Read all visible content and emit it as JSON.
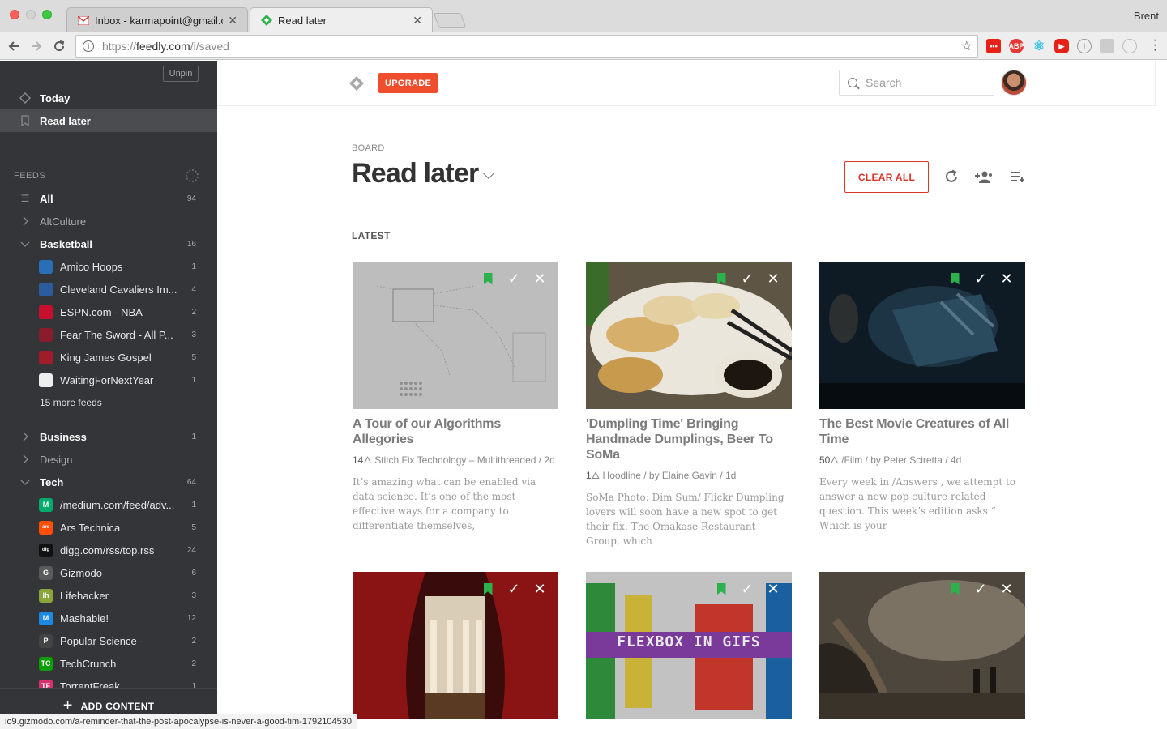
{
  "browser": {
    "tabs": [
      {
        "title": "Inbox - karmapoint@gmail.com",
        "active": false
      },
      {
        "title": "Read later",
        "active": true
      }
    ],
    "profile_name": "Brent",
    "url_prefix": "https://",
    "url_host": "feedly.com",
    "url_path": "/i/saved",
    "status_url": "io9.gizmodo.com/a-reminder-that-the-post-apocalypse-is-never-a-good-tim-1792104530"
  },
  "sidebar": {
    "unpin_label": "Unpin",
    "today_label": "Today",
    "read_later_label": "Read later",
    "feeds_header": "FEEDS",
    "all": {
      "label": "All",
      "count": "94"
    },
    "altculture": {
      "label": "AltCulture"
    },
    "basketball": {
      "label": "Basketball",
      "count": "16",
      "feeds": [
        {
          "label": "Amico Hoops",
          "count": "1",
          "color": "#2a6fb5",
          "icon": "amico-hoops-icon"
        },
        {
          "label": "Cleveland Cavaliers Im...",
          "count": "4",
          "color": "#2d5c9e",
          "icon": "cavaliers-icon"
        },
        {
          "label": "ESPN.com - NBA",
          "count": "2",
          "color": "#c8102e",
          "icon": "espn-icon"
        },
        {
          "label": "Fear The Sword - All P...",
          "count": "3",
          "color": "#8a1c2b",
          "icon": "fear-the-sword-icon"
        },
        {
          "label": "King James Gospel",
          "count": "5",
          "color": "#a11c2b",
          "icon": "king-james-gospel-icon"
        },
        {
          "label": "WaitingForNextYear",
          "count": "1",
          "color": "#eeeeee",
          "icon": "wfny-icon"
        }
      ],
      "more": "15 more feeds"
    },
    "business": {
      "label": "Business",
      "count": "1"
    },
    "design": {
      "label": "Design"
    },
    "tech": {
      "label": "Tech",
      "count": "64",
      "feeds": [
        {
          "label": "/medium.com/feed/adv...",
          "count": "1",
          "color": "#00ab6c",
          "icon": "medium-icon",
          "glyph": "M"
        },
        {
          "label": "Ars Technica",
          "count": "5",
          "color": "#ff4e00",
          "icon": "ars-technica-icon",
          "glyph": "ars"
        },
        {
          "label": "digg.com/rss/top.rss",
          "count": "24",
          "color": "#111111",
          "icon": "digg-icon",
          "glyph": "digg"
        },
        {
          "label": "Gizmodo",
          "count": "6",
          "color": "#5a5a5a",
          "icon": "gizmodo-icon",
          "glyph": "G"
        },
        {
          "label": "Lifehacker",
          "count": "3",
          "color": "#8aa63b",
          "icon": "lifehacker-icon",
          "glyph": "lh"
        },
        {
          "label": "Mashable!",
          "count": "12",
          "color": "#1e88e5",
          "icon": "mashable-icon",
          "glyph": "M"
        },
        {
          "label": "Popular Science -",
          "count": "2",
          "color": "#444444",
          "icon": "popular-science-icon",
          "glyph": "P"
        },
        {
          "label": "TechCrunch",
          "count": "2",
          "color": "#0a9e01",
          "icon": "techcrunch-icon",
          "glyph": "TC"
        },
        {
          "label": "TorrentFreak",
          "count": "1",
          "color": "#d6336c",
          "icon": "torrentfreak-icon",
          "glyph": "TF"
        }
      ]
    },
    "add_content": "ADD CONTENT"
  },
  "header": {
    "upgrade_label": "UPGRADE",
    "search_placeholder": "Search"
  },
  "board": {
    "label": "BOARD",
    "title": "Read later",
    "clear_all_label": "CLEAR ALL",
    "section_label": "LATEST"
  },
  "cards": [
    {
      "title": "A Tour of our Algorithms Allegories",
      "engagement": "14",
      "meta": "Stitch Fix Technology – Multithreaded / 2d",
      "excerpt": "It’s amazing what can be enabled via data science. It’s one of the most effective ways for a company to differentiate themselves,"
    },
    {
      "title": "'Dumpling Time' Bringing Handmade Dumplings, Beer To SoMa",
      "engagement": "1",
      "meta": "Hoodline / by Elaine Gavin / 1d",
      "excerpt": "SoMa Photo: Dim Sum/ Flickr Dumpling lovers will soon have a new spot to get their fix. The Omakase Restaurant Group, which"
    },
    {
      "title": "The Best Movie Creatures of All Time",
      "engagement": "50",
      "meta": "/Film / by Peter Sciretta / 4d",
      "excerpt": "Every week in /Answers , we attempt to answer a new pop culture-related question. This week’s edition asks “ Which is your"
    },
    {
      "title": "",
      "image_text": ""
    },
    {
      "title": "",
      "image_text": "FLEXBOX IN GIFS"
    },
    {
      "title": "",
      "image_text": ""
    }
  ],
  "colors": {
    "sidebar_bg": "#333538",
    "accent_red": "#ee4e2e",
    "bookmark_green": "#2bb24c",
    "clear_all_red": "#d9352a"
  }
}
